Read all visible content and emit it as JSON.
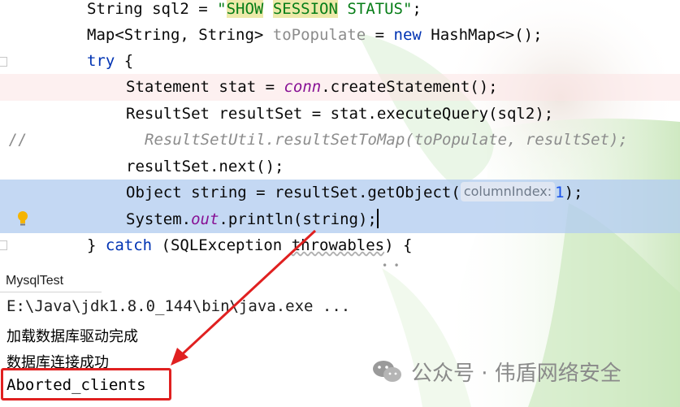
{
  "editor": {
    "comment_marker": "//",
    "lines": [
      {
        "pre": "String sql2 = ",
        "str": "\"",
        "hl1": "SHOW",
        "sp": " ",
        "hl2": "SESSION",
        "rest": " STATUS\"",
        "end": ";"
      },
      {
        "pre": "Map<String, String> ",
        "var": "toPopulate",
        "mid": " = ",
        "kw": "new",
        "post": " HashMap<>();"
      },
      {
        "kw": "try",
        "post": " {"
      },
      {
        "pre": "Statement stat = ",
        "field": "conn",
        "post": ".createStatement();"
      },
      {
        "text": "ResultSet resultSet = stat.executeQuery(sql2);"
      },
      {
        "text": "ResultSetUtil.resultSetToMap(toPopulate, resultSet);"
      },
      {
        "text": "resultSet.next();"
      },
      {
        "pre": "Object string = resultSet.getObject(",
        "hint": "columnIndex:",
        "num": "1",
        "post": ");"
      },
      {
        "pre": "System.",
        "field": "out",
        "post": ".println(string);"
      },
      {
        "pre": "} ",
        "kw": "catch",
        "mid": " (SQLException ",
        "squig": "throwables",
        "post": ") {"
      }
    ]
  },
  "console": {
    "tab_label": "MysqlTest",
    "command": "E:\\Java\\jdk1.8.0_144\\bin\\java.exe ...",
    "lines": [
      "加载数据库驱动完成",
      "数据库连接成功"
    ],
    "result": "Aborted_clients"
  },
  "watermark": {
    "text": "公众号 · 伟盾网络安全",
    "icon": "wechat-icon"
  },
  "colors": {
    "keyword": "#0033b3",
    "string": "#067d17",
    "field": "#871094",
    "comment": "#8c8c8c",
    "selection": "#b4cdf0",
    "annotation_red": "#e02020"
  }
}
